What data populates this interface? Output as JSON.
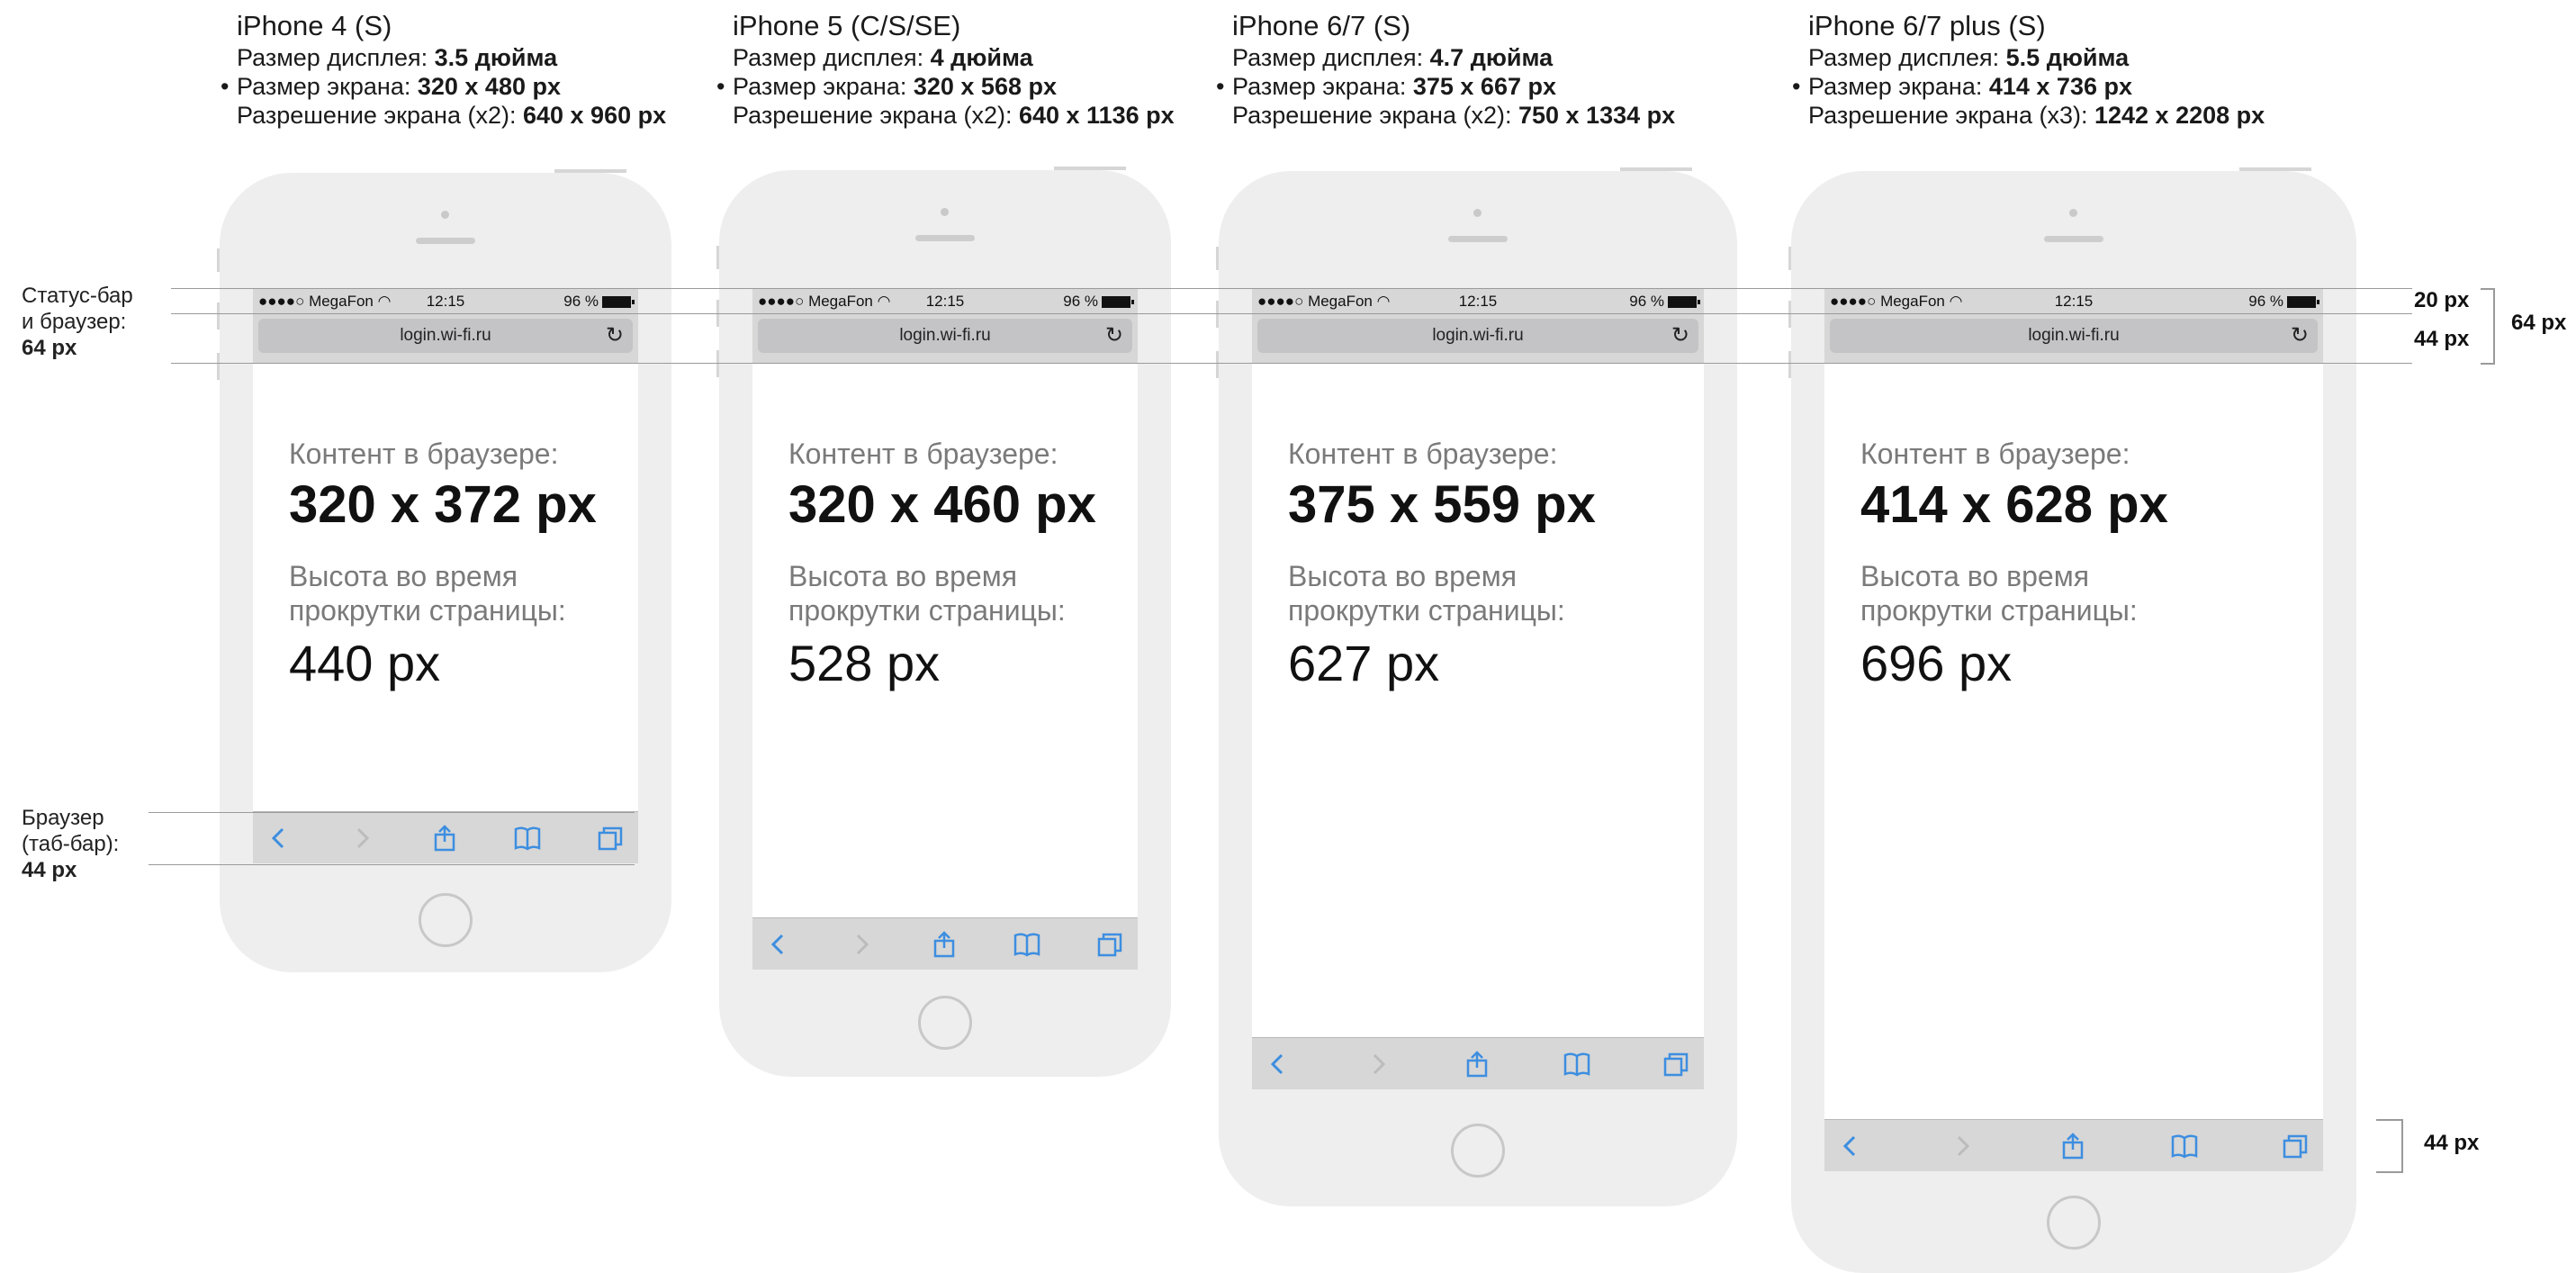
{
  "phones": [
    {
      "model": "iPhone 4 (S)",
      "display_label": "Размер дисплея: ",
      "display_value": "3.5 дюйма",
      "screen_label": "Размер экрана: ",
      "screen_value": "320 x 480 px",
      "res_label": "Разрешение экрана (x2): ",
      "res_value": "640 x 960 px",
      "content_label": "Контент в браузере:",
      "content_size": "320 x 372 px",
      "scroll_label": "Высота во время прокрутки страницы:",
      "scroll_value": "440 px"
    },
    {
      "model": "iPhone 5 (C/S/SE)",
      "display_label": "Размер дисплея: ",
      "display_value": "4 дюйма",
      "screen_label": "Размер экрана: ",
      "screen_value": "320 x 568 px",
      "res_label": "Разрешение экрана (x2): ",
      "res_value": "640 x 1136 px",
      "content_label": "Контент в браузере:",
      "content_size": "320 x 460 px",
      "scroll_label": "Высота во время прокрутки страницы:",
      "scroll_value": "528 px"
    },
    {
      "model": "iPhone 6/7 (S)",
      "display_label": "Размер дисплея: ",
      "display_value": "4.7 дюйма",
      "screen_label": "Размер экрана: ",
      "screen_value": "375 x 667 px",
      "res_label": "Разрешение экрана (x2): ",
      "res_value": "750 x 1334 px",
      "content_label": "Контент в браузере:",
      "content_size": "375 x 559 px",
      "scroll_label": "Высота во время прокрутки страницы:",
      "scroll_value": "627 px"
    },
    {
      "model": "iPhone 6/7 plus (S)",
      "display_label": "Размер дисплея: ",
      "display_value": "5.5 дюйма",
      "screen_label": "Размер экрана: ",
      "screen_value": "414 x 736 px",
      "res_label": "Разрешение экрана (x3): ",
      "res_value": "1242 x 2208 px",
      "content_label": "Контент в браузере:",
      "content_size": "414 x 628 px",
      "scroll_label": "Высота во время прокрутки страницы:",
      "scroll_value": "696 px"
    }
  ],
  "status_bar": {
    "carrier": "●●●●○ MegaFon",
    "time": "12:15",
    "battery": "96 %"
  },
  "browser": {
    "url": "login.wi-fi.ru",
    "reload_icon": "reload-icon"
  },
  "tab_icons": [
    "back-arrow-icon",
    "forward-arrow-icon",
    "share-icon",
    "bookmarks-icon",
    "tabs-icon"
  ],
  "left_notes": {
    "statusbar_note_line1": "Статус-бар",
    "statusbar_note_line2": "и браузер:",
    "statusbar_note_value": "64 px",
    "tabbar_note_line1": "Браузер",
    "tabbar_note_line2": "(таб-бар):",
    "tabbar_note_value": "44 px"
  },
  "right_dims": {
    "status": "20 px",
    "url": "44 px",
    "total": "64 px",
    "tabbar": "44 px"
  },
  "colors": {
    "phone_body": "#eeeeee",
    "bar_gray": "#d7d7d7",
    "icon_blue": "#3d8ee0",
    "muted_text": "#7a7a7a"
  }
}
